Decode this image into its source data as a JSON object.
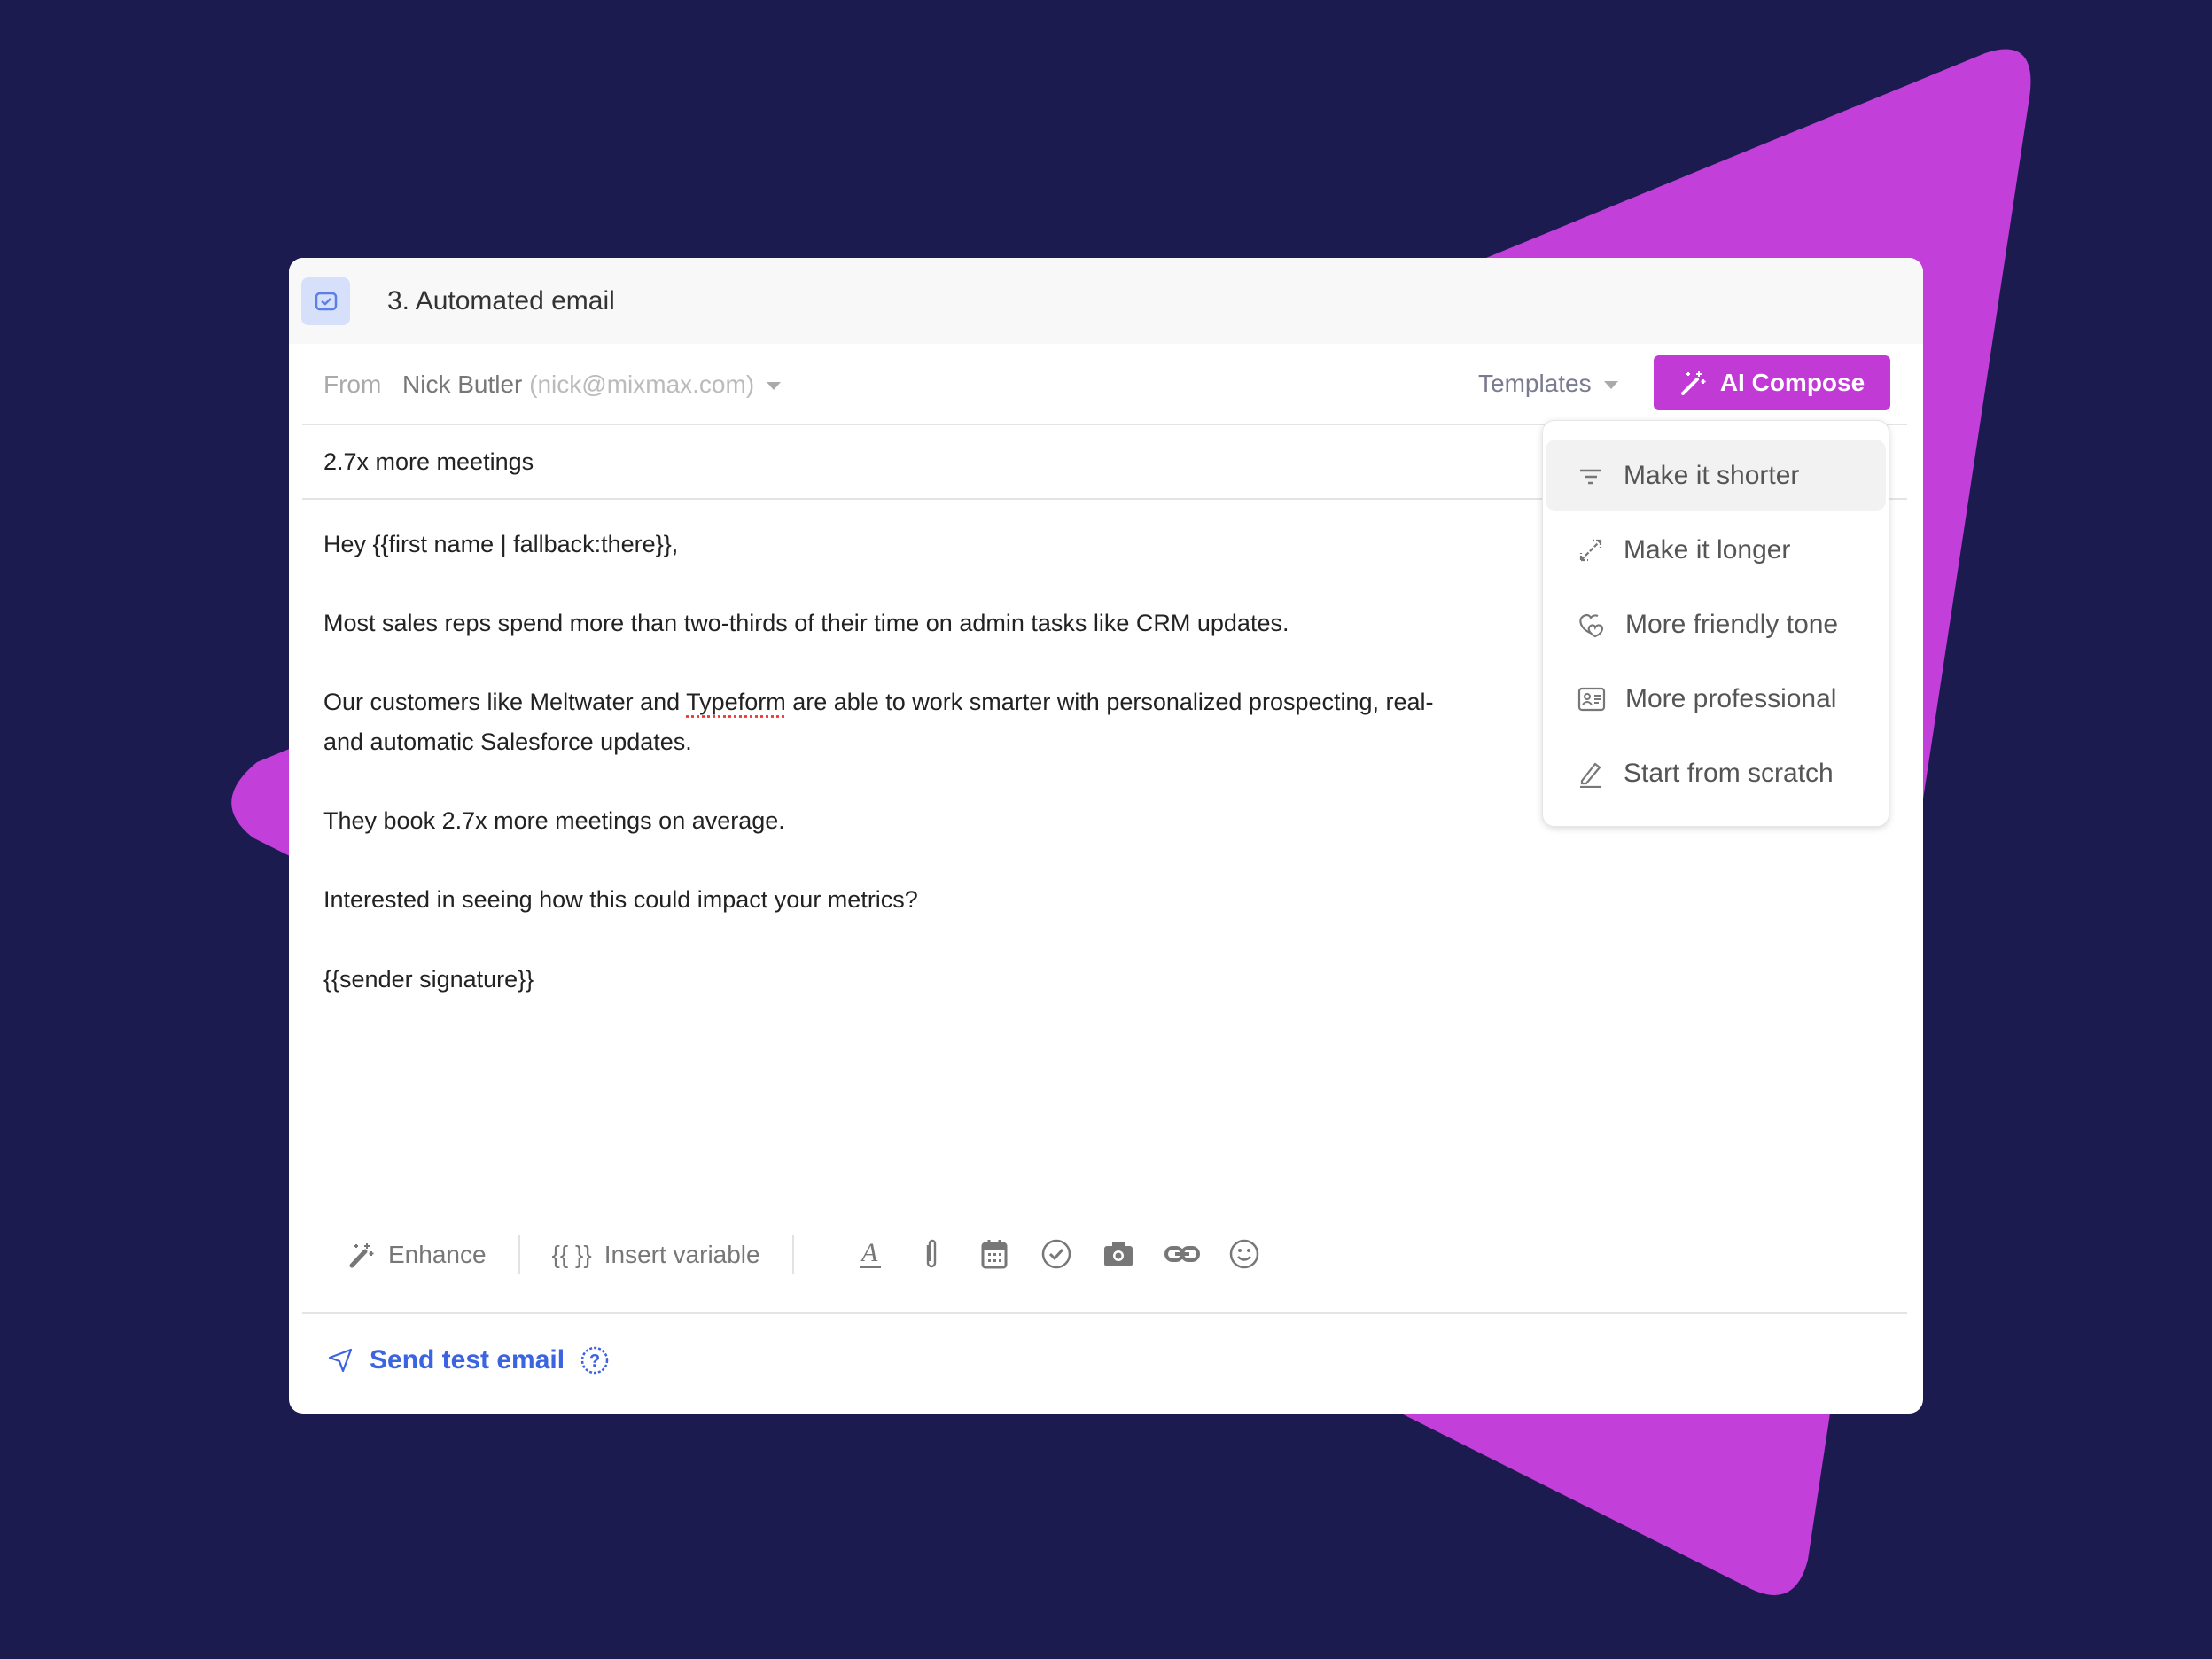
{
  "colors": {
    "background": "#1c1b4f",
    "accent": "#c23ad6",
    "link": "#3c63e0"
  },
  "header": {
    "title": "3. Automated email",
    "icon": "sequence-step-icon"
  },
  "from": {
    "label": "From",
    "name": "Nick Butler",
    "email": "(nick@mixmax.com)"
  },
  "templates_label": "Templates",
  "ai_compose_label": "AI Compose",
  "subject": "2.7x more meetings",
  "body": {
    "greeting": "Hey {{first name | fallback:there}},",
    "p1": "Most sales reps spend more than two-thirds of their time on admin tasks like CRM updates.",
    "p2a_pre": "Our customers like Meltwater and ",
    "p2a_spell": "Typeform",
    "p2a_post": " are able to work smarter with personalized prospecting, real-",
    "p2b": "and automatic Salesforce updates.",
    "p3": "They book 2.7x more meetings on average.",
    "p4": "Interested in seeing how this could impact your metrics?",
    "signature": "{{sender signature}}"
  },
  "toolbar": {
    "enhance": "Enhance",
    "insert_variable": "Insert variable",
    "variable_glyph": "{{ }}"
  },
  "footer": {
    "send_test": "Send test email"
  },
  "ai_menu": [
    {
      "label": "Make it shorter",
      "icon": "filter-lines-icon",
      "highlighted": true
    },
    {
      "label": "Make it longer",
      "icon": "expand-arrows-icon"
    },
    {
      "label": "More friendly tone",
      "icon": "hearts-icon"
    },
    {
      "label": "More professional",
      "icon": "id-card-icon"
    },
    {
      "label": "Start from scratch",
      "icon": "pencil-icon"
    }
  ]
}
